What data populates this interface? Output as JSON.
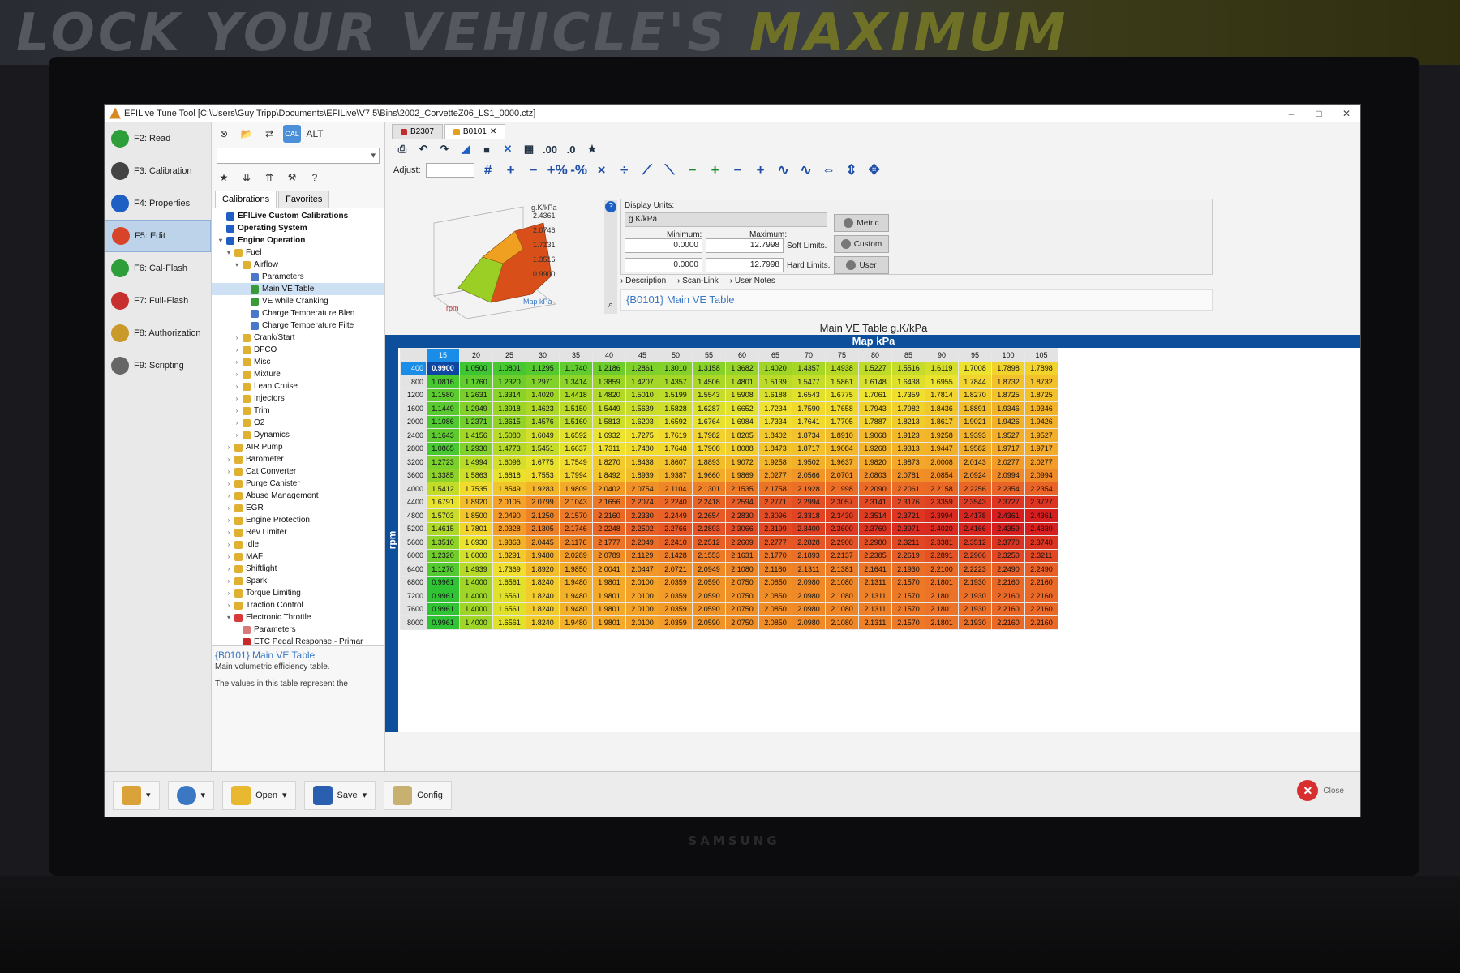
{
  "window": {
    "title": "EFILive Tune Tool [C:\\Users\\Guy Tripp\\Documents\\EFILive\\V7.5\\Bins\\2002_CorvetteZ06_LS1_0000.ctz]"
  },
  "left_nav": [
    {
      "label": "F2: Read",
      "icon": "green-arrow-icon",
      "color": "#2e9e3a"
    },
    {
      "label": "F3: Calibration",
      "icon": "binoculars-icon",
      "color": "#444444"
    },
    {
      "label": "F4: Properties",
      "icon": "info-icon",
      "color": "#1f5fc4"
    },
    {
      "label": "F5: Edit",
      "icon": "edit-triangle-icon",
      "color": "#d8442a"
    },
    {
      "label": "F6: Cal-Flash",
      "icon": "flash-icon",
      "color": "#2e9e3a"
    },
    {
      "label": "F7: Full-Flash",
      "icon": "full-flash-icon",
      "color": "#c83030"
    },
    {
      "label": "F8: Authorization",
      "icon": "key-icon",
      "color": "#c99a2a"
    },
    {
      "label": "F9: Scripting",
      "icon": "script-icon",
      "color": "#666666"
    }
  ],
  "tree_tabs": [
    "Calibrations",
    "Favorites"
  ],
  "tree": [
    {
      "label": "EFILive Custom Calibrations",
      "level": 0,
      "bold": true,
      "tw": "",
      "color": "#1f5fc4"
    },
    {
      "label": "Operating System",
      "level": 0,
      "bold": true,
      "tw": "",
      "color": "#1f5fc4"
    },
    {
      "label": "Engine Operation",
      "level": 0,
      "bold": true,
      "tw": "v",
      "color": "#1f5fc4"
    },
    {
      "label": "Fuel",
      "level": 1,
      "tw": "v",
      "color": "#e0b030"
    },
    {
      "label": "Airflow",
      "level": 2,
      "tw": "v",
      "color": "#e0b030"
    },
    {
      "label": "Parameters",
      "level": 3,
      "tw": "",
      "color": "#4a78c8"
    },
    {
      "label": "Main VE Table",
      "level": 3,
      "tw": "",
      "color": "#3a9a3a",
      "sel": true
    },
    {
      "label": "VE while Cranking",
      "level": 3,
      "tw": "",
      "color": "#3a9a3a"
    },
    {
      "label": "Charge Temperature Blen",
      "level": 3,
      "tw": "",
      "color": "#4a78c8"
    },
    {
      "label": "Charge Temperature Filte",
      "level": 3,
      "tw": "",
      "color": "#4a78c8"
    },
    {
      "label": "Crank/Start",
      "level": 2,
      "tw": ">",
      "color": "#e0b030"
    },
    {
      "label": "DFCO",
      "level": 2,
      "tw": ">",
      "color": "#e0b030"
    },
    {
      "label": "Misc",
      "level": 2,
      "tw": ">",
      "color": "#e0b030"
    },
    {
      "label": "Mixture",
      "level": 2,
      "tw": ">",
      "color": "#e0b030"
    },
    {
      "label": "Lean Cruise",
      "level": 2,
      "tw": ">",
      "color": "#e0b030"
    },
    {
      "label": "Injectors",
      "level": 2,
      "tw": ">",
      "color": "#e0b030"
    },
    {
      "label": "Trim",
      "level": 2,
      "tw": ">",
      "color": "#e0b030"
    },
    {
      "label": "O2",
      "level": 2,
      "tw": ">",
      "color": "#e0b030"
    },
    {
      "label": "Dynamics",
      "level": 2,
      "tw": ">",
      "color": "#e0b030"
    },
    {
      "label": "AIR Pump",
      "level": 1,
      "tw": ">",
      "color": "#e0b030"
    },
    {
      "label": "Barometer",
      "level": 1,
      "tw": ">",
      "color": "#e0b030"
    },
    {
      "label": "Cat Converter",
      "level": 1,
      "tw": ">",
      "color": "#e0b030"
    },
    {
      "label": "Purge Canister",
      "level": 1,
      "tw": ">",
      "color": "#e0b030"
    },
    {
      "label": "Abuse Management",
      "level": 1,
      "tw": ">",
      "color": "#e0b030"
    },
    {
      "label": "EGR",
      "level": 1,
      "tw": ">",
      "color": "#e0b030"
    },
    {
      "label": "Engine Protection",
      "level": 1,
      "tw": ">",
      "color": "#e0b030"
    },
    {
      "label": "Rev Limiter",
      "level": 1,
      "tw": ">",
      "color": "#e0b030"
    },
    {
      "label": "Idle",
      "level": 1,
      "tw": ">",
      "color": "#e0b030"
    },
    {
      "label": "MAF",
      "level": 1,
      "tw": ">",
      "color": "#e0b030"
    },
    {
      "label": "Shiftlight",
      "level": 1,
      "tw": ">",
      "color": "#e0b030"
    },
    {
      "label": "Spark",
      "level": 1,
      "tw": ">",
      "color": "#e0b030"
    },
    {
      "label": "Torque Limiting",
      "level": 1,
      "tw": ">",
      "color": "#e0b030"
    },
    {
      "label": "Traction Control",
      "level": 1,
      "tw": ">",
      "color": "#e0b030"
    },
    {
      "label": "Electronic Throttle",
      "level": 1,
      "tw": "v",
      "color": "#d83a3a"
    },
    {
      "label": "Parameters",
      "level": 2,
      "tw": "",
      "color": "#d87a7a"
    },
    {
      "label": "ETC Pedal Response - Primar",
      "level": 2,
      "tw": "",
      "color": "#c82a2a"
    },
    {
      "label": "ETC Pedal Response - Alterna",
      "level": 2,
      "tw": "",
      "color": "#c82a2a"
    },
    {
      "label": "ETC Max Position",
      "level": 2,
      "tw": "",
      "color": "#c82a2a"
    },
    {
      "label": "Engine Diagnostics",
      "level": 0,
      "bold": true,
      "tw": "v",
      "color": "#1f5fc4"
    },
    {
      "label": "Engine DTC Processing Enablers",
      "level": 1,
      "tw": "",
      "color": "#d87a7a"
    },
    {
      "label": "Engine DTC MIL Enablers",
      "level": 1,
      "tw": "",
      "color": "#d87a7a"
    },
    {
      "label": "Cat Converter",
      "level": 1,
      "tw": ">",
      "color": "#e0b030"
    }
  ],
  "info": {
    "title": "{B0101} Main VE Table",
    "line1": "Main volumetric efficiency table.",
    "line2": "The values in this table represent the"
  },
  "bottom_buttons": {
    "open": "Open",
    "save": "Save",
    "config": "Config",
    "close": "Close"
  },
  "doc_tabs": [
    {
      "label": "B2307",
      "color": "#c82a2a"
    },
    {
      "label": "B0101",
      "color": "#e0a020"
    }
  ],
  "adjust_label": "Adjust:",
  "surface_labels": {
    "z_max": "g.K/kPa",
    "z_ticks": [
      "2.4361",
      "2.0746",
      "1.7131",
      "1.3516",
      "0.9900"
    ],
    "x_label": "Map kPa",
    "y_label": "rpm"
  },
  "props": {
    "display_units_label": "Display Units:",
    "display_units_value": "g.K/kPa",
    "min_label": "Minimum:",
    "max_label": "Maximum:",
    "soft_min": "0.0000",
    "soft_max": "12.7998",
    "soft_label": "Soft Limits.",
    "hard_min": "0.0000",
    "hard_max": "12.7998",
    "hard_label": "Hard Limits.",
    "btn_metric": "Metric",
    "btn_custom": "Custom",
    "btn_user": "User"
  },
  "desc_tabs": [
    "Description",
    "Scan-Link",
    "User Notes"
  ],
  "desc_title": "{B0101} Main VE Table",
  "table_title": "Main VE Table g.K/kPa",
  "col_axis_label": "Map kPa",
  "row_axis_label": "rpm",
  "color_scale": {
    "min": 0.99,
    "max": 2.4361
  },
  "ve_table": {
    "cols": [
      "15",
      "20",
      "25",
      "30",
      "35",
      "40",
      "45",
      "50",
      "55",
      "60",
      "65",
      "70",
      "75",
      "80",
      "85",
      "90",
      "95",
      "100",
      "105"
    ],
    "rows": [
      {
        "rpm": "400",
        "v": [
          "0.9900",
          "1.0500",
          "1.0801",
          "1.1295",
          "1.1740",
          "1.2186",
          "1.2861",
          "1.3010",
          "1.3158",
          "1.3682",
          "1.4020",
          "1.4357",
          "1.4938",
          "1.5227",
          "1.5516",
          "1.6119",
          "1.7008",
          "1.7898",
          "1.7898"
        ]
      },
      {
        "rpm": "800",
        "v": [
          "1.0816",
          "1.1760",
          "1.2320",
          "1.2971",
          "1.3414",
          "1.3859",
          "1.4207",
          "1.4357",
          "1.4506",
          "1.4801",
          "1.5139",
          "1.5477",
          "1.5861",
          "1.6148",
          "1.6438",
          "1.6955",
          "1.7844",
          "1.8732",
          "1.8732"
        ]
      },
      {
        "rpm": "1200",
        "v": [
          "1.1580",
          "1.2631",
          "1.3314",
          "1.4020",
          "1.4418",
          "1.4820",
          "1.5010",
          "1.5199",
          "1.5543",
          "1.5908",
          "1.6188",
          "1.6543",
          "1.6775",
          "1.7061",
          "1.7359",
          "1.7814",
          "1.8270",
          "1.8725",
          "1.8725"
        ]
      },
      {
        "rpm": "1600",
        "v": [
          "1.1449",
          "1.2949",
          "1.3918",
          "1.4623",
          "1.5150",
          "1.5449",
          "1.5639",
          "1.5828",
          "1.6287",
          "1.6652",
          "1.7234",
          "1.7590",
          "1.7658",
          "1.7943",
          "1.7982",
          "1.8436",
          "1.8891",
          "1.9346",
          "1.9346"
        ]
      },
      {
        "rpm": "2000",
        "v": [
          "1.1086",
          "1.2371",
          "1.3615",
          "1.4576",
          "1.5160",
          "1.5813",
          "1.6203",
          "1.6592",
          "1.6764",
          "1.6984",
          "1.7334",
          "1.7641",
          "1.7705",
          "1.7887",
          "1.8213",
          "1.8617",
          "1.9021",
          "1.9426",
          "1.9426"
        ]
      },
      {
        "rpm": "2400",
        "v": [
          "1.1643",
          "1.4156",
          "1.5080",
          "1.6049",
          "1.6592",
          "1.6932",
          "1.7275",
          "1.7619",
          "1.7982",
          "1.8205",
          "1.8402",
          "1.8734",
          "1.8910",
          "1.9068",
          "1.9123",
          "1.9258",
          "1.9393",
          "1.9527",
          "1.9527"
        ]
      },
      {
        "rpm": "2800",
        "v": [
          "1.0865",
          "1.2930",
          "1.4773",
          "1.5451",
          "1.6637",
          "1.7311",
          "1.7480",
          "1.7648",
          "1.7908",
          "1.8088",
          "1.8473",
          "1.8717",
          "1.9084",
          "1.9268",
          "1.9313",
          "1.9447",
          "1.9582",
          "1.9717",
          "1.9717"
        ]
      },
      {
        "rpm": "3200",
        "v": [
          "1.2723",
          "1.4994",
          "1.6096",
          "1.6775",
          "1.7549",
          "1.8270",
          "1.8438",
          "1.8607",
          "1.8893",
          "1.9072",
          "1.9258",
          "1.9502",
          "1.9637",
          "1.9820",
          "1.9873",
          "2.0008",
          "2.0143",
          "2.0277",
          "2.0277"
        ]
      },
      {
        "rpm": "3600",
        "v": [
          "1.3385",
          "1.5863",
          "1.6818",
          "1.7553",
          "1.7994",
          "1.8492",
          "1.8939",
          "1.9387",
          "1.9660",
          "1.9869",
          "2.0277",
          "2.0566",
          "2.0701",
          "2.0803",
          "2.0781",
          "2.0854",
          "2.0924",
          "2.0994",
          "2.0994"
        ]
      },
      {
        "rpm": "4000",
        "v": [
          "1.5412",
          "1.7535",
          "1.8549",
          "1.9283",
          "1.9809",
          "2.0402",
          "2.0754",
          "2.1104",
          "2.1301",
          "2.1535",
          "2.1758",
          "2.1928",
          "2.1998",
          "2.2090",
          "2.2061",
          "2.2158",
          "2.2256",
          "2.2354",
          "2.2354"
        ]
      },
      {
        "rpm": "4400",
        "v": [
          "1.6791",
          "1.8920",
          "2.0105",
          "2.0799",
          "2.1043",
          "2.1656",
          "2.2074",
          "2.2240",
          "2.2418",
          "2.2594",
          "2.2771",
          "2.2994",
          "2.3057",
          "2.3141",
          "2.3176",
          "2.3359",
          "2.3543",
          "2.3727",
          "2.3727"
        ]
      },
      {
        "rpm": "4800",
        "v": [
          "1.5703",
          "1.8500",
          "2.0490",
          "2.1250",
          "2.1570",
          "2.2160",
          "2.2330",
          "2.2449",
          "2.2654",
          "2.2830",
          "2.3096",
          "2.3318",
          "2.3430",
          "2.3514",
          "2.3721",
          "2.3994",
          "2.4178",
          "2.4361",
          "2.4361"
        ]
      },
      {
        "rpm": "5200",
        "v": [
          "1.4615",
          "1.7801",
          "2.0328",
          "2.1305",
          "2.1746",
          "2.2248",
          "2.2502",
          "2.2766",
          "2.2893",
          "2.3066",
          "2.3199",
          "2.3400",
          "2.3600",
          "2.3760",
          "2.3971",
          "2.4020",
          "2.4166",
          "2.4359",
          "2.4330"
        ]
      },
      {
        "rpm": "5600",
        "v": [
          "1.3510",
          "1.6930",
          "1.9363",
          "2.0445",
          "2.1176",
          "2.1777",
          "2.2049",
          "2.2410",
          "2.2512",
          "2.2609",
          "2.2777",
          "2.2828",
          "2.2900",
          "2.2980",
          "2.3211",
          "2.3381",
          "2.3512",
          "2.3770",
          "2.3740"
        ]
      },
      {
        "rpm": "6000",
        "v": [
          "1.2320",
          "1.6000",
          "1.8291",
          "1.9480",
          "2.0289",
          "2.0789",
          "2.1129",
          "2.1428",
          "2.1553",
          "2.1631",
          "2.1770",
          "2.1893",
          "2.2137",
          "2.2385",
          "2.2619",
          "2.2891",
          "2.2906",
          "2.3250",
          "2.3211"
        ]
      },
      {
        "rpm": "6400",
        "v": [
          "1.1270",
          "1.4939",
          "1.7369",
          "1.8920",
          "1.9850",
          "2.0041",
          "2.0447",
          "2.0721",
          "2.0949",
          "2.1080",
          "2.1180",
          "2.1311",
          "2.1381",
          "2.1641",
          "2.1930",
          "2.2100",
          "2.2223",
          "2.2490",
          "2.2490"
        ]
      },
      {
        "rpm": "6800",
        "v": [
          "0.9961",
          "1.4000",
          "1.6561",
          "1.8240",
          "1.9480",
          "1.9801",
          "2.0100",
          "2.0359",
          "2.0590",
          "2.0750",
          "2.0850",
          "2.0980",
          "2.1080",
          "2.1311",
          "2.1570",
          "2.1801",
          "2.1930",
          "2.2160",
          "2.2160"
        ]
      },
      {
        "rpm": "7200",
        "v": [
          "0.9961",
          "1.4000",
          "1.6561",
          "1.8240",
          "1.9480",
          "1.9801",
          "2.0100",
          "2.0359",
          "2.0590",
          "2.0750",
          "2.0850",
          "2.0980",
          "2.1080",
          "2.1311",
          "2.1570",
          "2.1801",
          "2.1930",
          "2.2160",
          "2.2160"
        ]
      },
      {
        "rpm": "7600",
        "v": [
          "0.9961",
          "1.4000",
          "1.6561",
          "1.8240",
          "1.9480",
          "1.9801",
          "2.0100",
          "2.0359",
          "2.0590",
          "2.0750",
          "2.0850",
          "2.0980",
          "2.1080",
          "2.1311",
          "2.1570",
          "2.1801",
          "2.1930",
          "2.2160",
          "2.2160"
        ]
      },
      {
        "rpm": "8000",
        "v": [
          "0.9961",
          "1.4000",
          "1.6561",
          "1.8240",
          "1.9480",
          "1.9801",
          "2.0100",
          "2.0359",
          "2.0590",
          "2.0750",
          "2.0850",
          "2.0980",
          "2.1080",
          "2.1311",
          "2.1570",
          "2.1801",
          "2.1930",
          "2.2160",
          "2.2160"
        ]
      }
    ]
  }
}
